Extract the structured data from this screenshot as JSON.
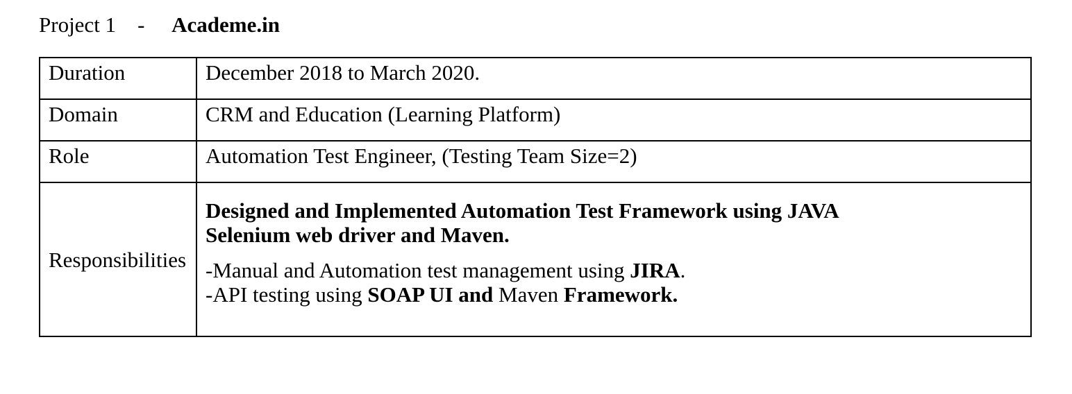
{
  "heading": {
    "label": "Project 1",
    "separator": "-",
    "name": "Academe.in"
  },
  "table": {
    "duration": {
      "key": "Duration",
      "value": "December 2018 to March 2020."
    },
    "domain": {
      "key": "Domain",
      "value": "CRM and Education (Learning Platform)"
    },
    "role": {
      "key": "Role",
      "value": "Automation Test Engineer, (Testing Team Size=2)"
    },
    "responsibilities": {
      "key": "Responsibilities",
      "title_line1": "Designed and Implemented Automation Test Framework using JAVA",
      "title_line2": "Selenium web driver and Maven.",
      "item1": {
        "prefix": "-Manual and Automation test management using ",
        "bold": "JIRA",
        "suffix": "."
      },
      "item2": {
        "prefix": "-API testing using ",
        "bold1": "SOAP UI and",
        "middle": " Maven ",
        "bold2": "Framework."
      }
    }
  }
}
